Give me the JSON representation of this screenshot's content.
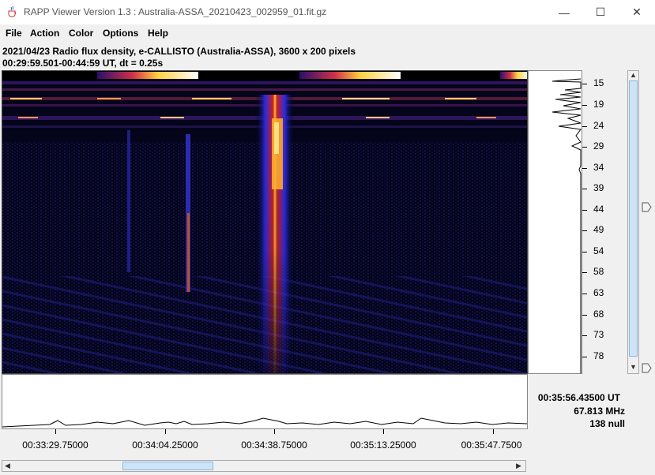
{
  "window": {
    "title": "RAPP Viewer Version 1.3 : Australia-ASSA_20210423_002959_01.fit.gz",
    "minimize_glyph": "—",
    "maximize_glyph": "☐",
    "close_glyph": "✕"
  },
  "menu": {
    "items": [
      "File",
      "Action",
      "Color",
      "Options",
      "Help"
    ]
  },
  "header": {
    "line1": "2021/04/23  Radio flux density, e-CALLISTO (Australia-ASSA),  3600 x 200 pixels",
    "line2": "00:29:59.501-00:44:59 UT,  dt = 0.25s"
  },
  "y_axis": {
    "labels": [
      "15",
      "19",
      "24",
      "29",
      "34",
      "39",
      "44",
      "49",
      "54",
      "58",
      "63",
      "68",
      "73",
      "78"
    ]
  },
  "x_axis": {
    "labels": [
      "00:33:29.75000",
      "00:34:04.25000",
      "00:34:38.75000",
      "00:35:13.25000",
      "00:35:47.7500"
    ]
  },
  "readout": {
    "time": "00:35:56.43500 UT",
    "frequency": "67.813 MHz",
    "value": "138 null"
  },
  "colors": {
    "background": "#000000",
    "burst_core": "#ffcc33",
    "burst_mid": "#dd2222",
    "burst_edge": "#3333ff",
    "noise": "#1a1a70"
  },
  "icons": {
    "app": "java-coffee-cup-icon",
    "up_arrow": "▲",
    "down_arrow": "▼",
    "left_arrow": "◀",
    "right_arrow": "▶"
  }
}
